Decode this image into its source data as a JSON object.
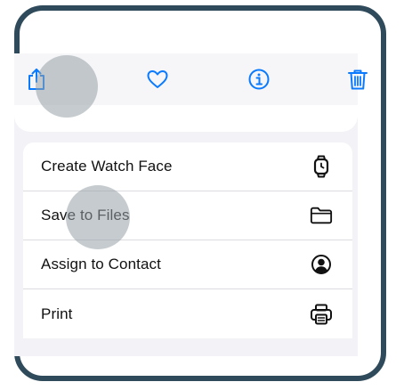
{
  "colors": {
    "frame_border": "#2f4a5a",
    "accent_blue": "#0a7aff",
    "menu_text": "#111111"
  },
  "toolbar": {
    "buttons": [
      {
        "icon": "share-icon"
      },
      {
        "icon": "heart-icon"
      },
      {
        "icon": "info-icon"
      },
      {
        "icon": "trash-icon"
      }
    ]
  },
  "menu": {
    "items": [
      {
        "label": "Create Watch Face",
        "icon": "watch-icon"
      },
      {
        "label": "Save to Files",
        "icon": "folder-icon"
      },
      {
        "label": "Assign to Contact",
        "icon": "contact-icon"
      },
      {
        "label": "Print",
        "icon": "printer-icon"
      }
    ]
  }
}
